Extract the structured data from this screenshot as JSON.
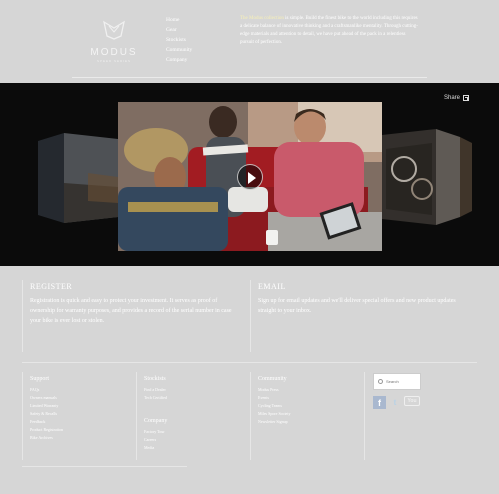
{
  "logo": {
    "text": "MODUS",
    "sub": "SPEED SERIES"
  },
  "nav": {
    "items": [
      "Home",
      "Gear",
      "Stockists",
      "Community",
      "Company"
    ]
  },
  "intro": {
    "brand": "The Modus collection",
    "text": " is simple. Build the finest bike to the world including this requires a delicate balance of innovative thinking and a craftsmanlike mentality. Through cutting-edge materials and attention to detail, we have put ahead of the pack in a relentless pursuit of perfection."
  },
  "stage": {
    "share_label": "Share"
  },
  "register": {
    "title": "REGISTER",
    "text": "Registration is quick and easy to protect your investment. It serves as proof of ownership for warranty purposes, and provides a record of the serial number in case your bike is ever lost or stolen."
  },
  "email": {
    "title": "EMAIL",
    "text": "Sign up for email updates and we'll deliver special offers and new product updates straight to your inbox."
  },
  "footer": {
    "support": {
      "title": "Support",
      "items": [
        "FAQs",
        "Owners manuals",
        "Limited Warranty",
        "Safety & Recalls",
        "Feedback",
        "Product Registration",
        "Bike Archives"
      ]
    },
    "stockists": {
      "title": "Stockists",
      "items": [
        "Find a Dealer",
        "Tech Certified"
      ]
    },
    "company": {
      "title": "Company",
      "items": [
        "Factory Tour",
        "Careers",
        "Media"
      ]
    },
    "community": {
      "title": "Community",
      "items": [
        "Modus Press",
        "Events",
        "Cycling Teams",
        "Miles Spore Society",
        "Newsletter Signup"
      ]
    },
    "search": {
      "placeholder": "Search"
    },
    "social": {
      "facebook": "f",
      "twitter": "t",
      "youtube": "You"
    }
  }
}
